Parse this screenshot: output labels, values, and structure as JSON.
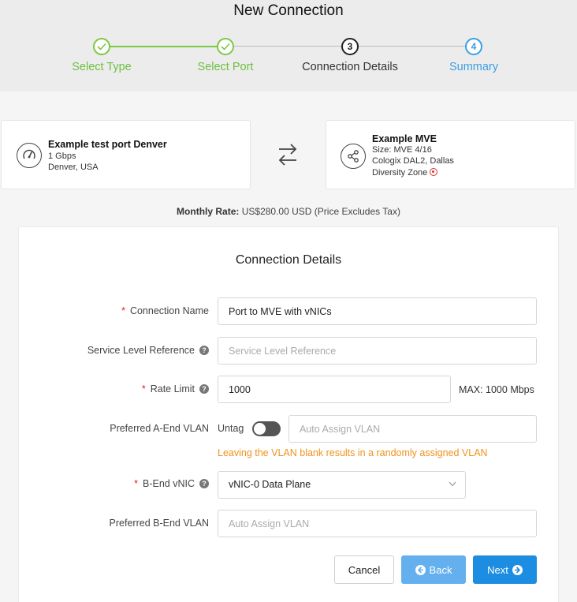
{
  "header": {
    "title": "New Connection"
  },
  "steps": [
    {
      "label": "Select Type",
      "state": "done"
    },
    {
      "label": "Select Port",
      "state": "done"
    },
    {
      "label": "Connection Details",
      "state": "current",
      "number": "3"
    },
    {
      "label": "Summary",
      "state": "todo",
      "number": "4"
    }
  ],
  "a_end": {
    "title": "Example test port Denver",
    "speed": "1 Gbps",
    "location": "Denver, USA",
    "icon": "speedometer-icon"
  },
  "b_end": {
    "title": "Example MVE",
    "size": "Size: MVE 4/16",
    "location": "Cologix DAL2, Dallas",
    "diversity": "Diversity Zone",
    "icon": "share-nodes-icon"
  },
  "rate": {
    "label": "Monthly Rate:",
    "value": "US$280.00 USD (Price Excludes Tax)"
  },
  "form": {
    "title": "Connection Details",
    "connection_name": {
      "label": "Connection Name",
      "value": "Port to MVE with vNICs",
      "required": true
    },
    "service_level_reference": {
      "label": "Service Level Reference",
      "placeholder": "Service Level Reference"
    },
    "rate_limit": {
      "label": "Rate Limit",
      "value": "1000",
      "max_text": "MAX: 1000 Mbps",
      "required": true
    },
    "a_end_vlan": {
      "label": "Preferred A-End VLAN",
      "untag_label": "Untag",
      "untag_on": false,
      "placeholder": "Auto Assign VLAN",
      "hint": "Leaving the VLAN blank results in a randomly assigned VLAN"
    },
    "b_end_vnic": {
      "label": "B-End vNIC",
      "value": "vNIC-0 Data Plane",
      "required": true
    },
    "b_end_vlan": {
      "label": "Preferred B-End VLAN",
      "placeholder": "Auto Assign VLAN"
    }
  },
  "buttons": {
    "cancel": "Cancel",
    "back": "Back",
    "next": "Next"
  },
  "colors": {
    "done": "#6cc03e",
    "current": "#333333",
    "todo": "#3a9ee5",
    "hint": "#f0921b",
    "required": "#e02020",
    "back_button": "#64b0ee",
    "next_button": "#1c8de0"
  }
}
